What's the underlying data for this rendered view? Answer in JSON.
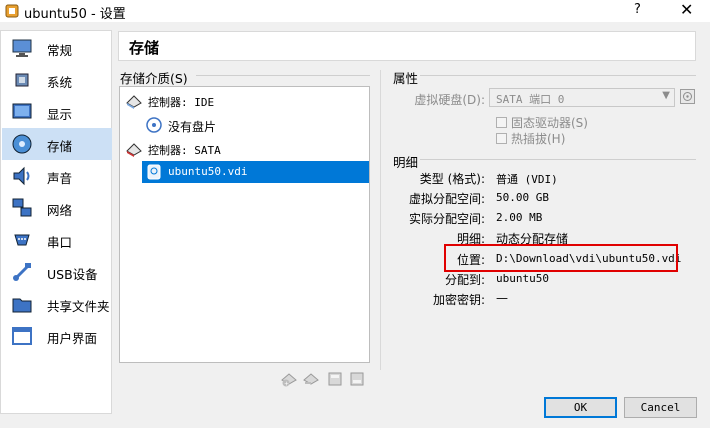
{
  "window": {
    "title": "ubuntu50 - 设置",
    "help": "?",
    "close": "✕"
  },
  "sidebar": {
    "items": [
      {
        "label": "常规",
        "icon": "monitor-icon"
      },
      {
        "label": "系统",
        "icon": "chip-icon"
      },
      {
        "label": "显示",
        "icon": "display-icon"
      },
      {
        "label": "存储",
        "icon": "disk-icon",
        "selected": true
      },
      {
        "label": "声音",
        "icon": "speaker-icon"
      },
      {
        "label": "网络",
        "icon": "network-icon"
      },
      {
        "label": "串口",
        "icon": "serial-port-icon"
      },
      {
        "label": "USB设备",
        "icon": "usb-icon"
      },
      {
        "label": "共享文件夹",
        "icon": "folder-icon"
      },
      {
        "label": "用户界面",
        "icon": "window-icon"
      }
    ]
  },
  "header": {
    "title": "存储"
  },
  "storage": {
    "label": "存储介质(S)",
    "tree": [
      {
        "text": "控制器: IDE"
      },
      {
        "text": "没有盘片"
      },
      {
        "text": "控制器: SATA"
      },
      {
        "text": "ubuntu50.vdi"
      }
    ]
  },
  "attributes": {
    "title": "属性",
    "virtual_disk_label": "虚拟硬盘(D):",
    "virtual_disk_value": "SATA 端口 0",
    "ssd_label": "固态驱动器(S)",
    "hotplug_label": "热插拔(H)"
  },
  "details": {
    "title": "明细",
    "rows": [
      {
        "label": "类型 (格式):",
        "value": "普通 (VDI)"
      },
      {
        "label": "虚拟分配空间:",
        "value": "50.00 GB"
      },
      {
        "label": "实际分配空间:",
        "value": "2.00 MB"
      },
      {
        "label": "明细:",
        "value": "动态分配存储"
      },
      {
        "label": "位置:",
        "value": "D:\\Download\\vdi\\ubuntu50.vdi"
      },
      {
        "label": "分配到:",
        "value": "ubuntu50"
      },
      {
        "label": "加密密钥:",
        "value": "—"
      }
    ]
  },
  "buttons": {
    "ok": "OK",
    "cancel": "Cancel"
  },
  "colors": {
    "selection": "#0078d7",
    "sidebar_selected": "#cce0f5",
    "highlight_box": "#e00000"
  }
}
